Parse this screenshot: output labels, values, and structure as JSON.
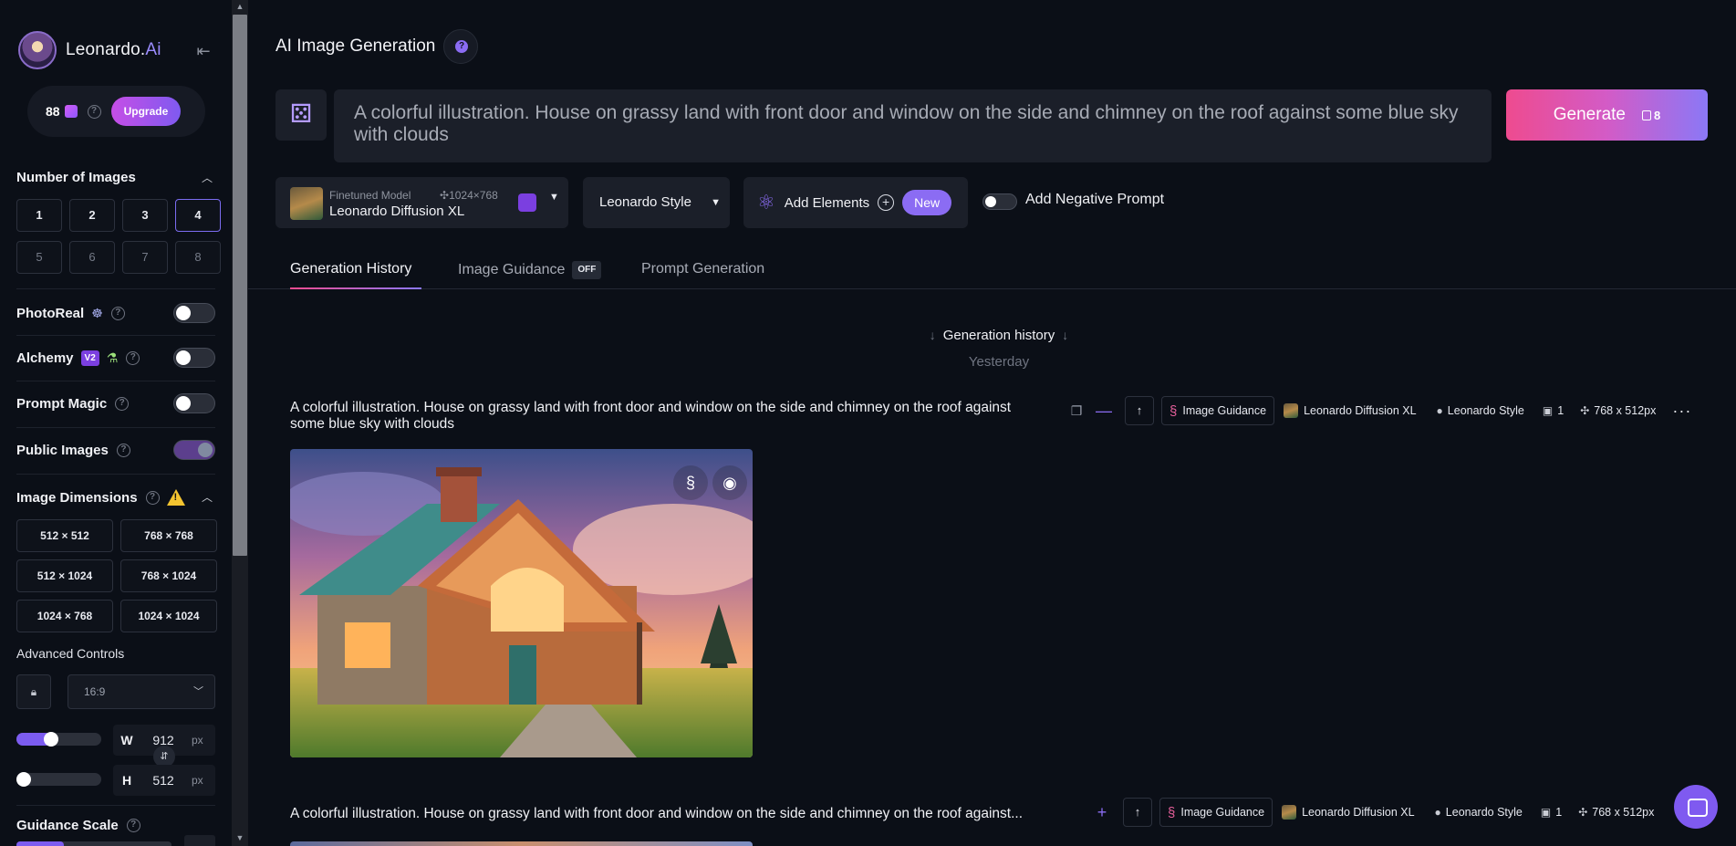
{
  "sidebar": {
    "brand": {
      "name": "Leonardo.",
      "name_suffix": "Ai"
    },
    "collapse_icon": "collapse-left-icon",
    "tokens": {
      "count": "88",
      "upgrade_label": "Upgrade"
    },
    "number_of_images": {
      "title": "Number of Images",
      "options": [
        "1",
        "2",
        "3",
        "4",
        "5",
        "6",
        "7",
        "8"
      ],
      "selected": "4"
    },
    "photoreal": {
      "label": "PhotoReal",
      "enabled": false
    },
    "alchemy": {
      "label": "Alchemy",
      "badge": "V2",
      "enabled": false
    },
    "prompt_magic": {
      "label": "Prompt Magic",
      "enabled": false
    },
    "public_images": {
      "label": "Public Images",
      "enabled": true
    },
    "image_dimensions": {
      "title": "Image Dimensions",
      "options": [
        "512 × 512",
        "768 × 768",
        "512 × 1024",
        "768 × 1024",
        "1024 × 768",
        "1024 × 1024"
      ]
    },
    "advanced_controls": {
      "label": "Advanced Controls",
      "aspect_ratio": "16:9",
      "width": {
        "key": "W",
        "value": "912",
        "unit": "px",
        "slider_fraction": 0.42
      },
      "height": {
        "key": "H",
        "value": "512",
        "unit": "px",
        "slider_fraction": 0.0
      }
    },
    "guidance_scale": {
      "title": "Guidance Scale"
    }
  },
  "header": {
    "title": "AI Image Generation"
  },
  "prompt": {
    "text": "A colorful illustration. House on grassy land with front door and window on the side and chimney on the roof against some blue sky with clouds"
  },
  "generate": {
    "label": "Generate",
    "cost": "8"
  },
  "model": {
    "sublabel": "Finetuned Model",
    "resolution": "1024×768",
    "name": "Leonardo Diffusion XL"
  },
  "style": {
    "label": "Leonardo Style"
  },
  "elements": {
    "label": "Add Elements",
    "badge": "New"
  },
  "negative_prompt": {
    "label": "Add Negative Prompt",
    "enabled": false
  },
  "tabs": [
    {
      "label": "Generation History",
      "active": true
    },
    {
      "label": "Image Guidance",
      "badge": "OFF"
    },
    {
      "label": "Prompt Generation"
    }
  ],
  "history": {
    "heading": "Generation history",
    "day": "Yesterday",
    "generations": [
      {
        "prompt": "A colorful illustration. House on grassy land with front door and window on the side and chimney on the roof against some blue sky with clouds",
        "guidance": "Image Guidance",
        "model": "Leonardo Diffusion XL",
        "style": "Leonardo Style",
        "count": "1",
        "size": "768 x 512px"
      },
      {
        "prompt": "A colorful illustration. House on grassy land with front door and window on the side and chimney on the roof against...",
        "guidance": "Image Guidance",
        "model": "Leonardo Diffusion XL",
        "style": "Leonardo Style",
        "count": "1",
        "size": "768 x 512px"
      }
    ]
  },
  "colors": {
    "accent": "#8b6cf3",
    "generate_gradient_start": "#ee4b8f",
    "generate_gradient_end": "#8b78f6",
    "background": "#0b0f17"
  }
}
